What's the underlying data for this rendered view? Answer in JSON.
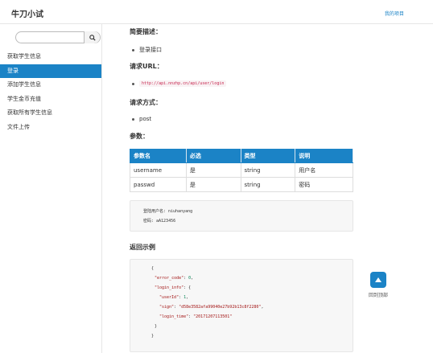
{
  "header": {
    "title": "牛刀小试",
    "project_link": "我的项目"
  },
  "sidebar": {
    "search_placeholder": "",
    "items": [
      {
        "label": "获取学生信息",
        "active": false
      },
      {
        "label": "登录",
        "active": true
      },
      {
        "label": "添加学生信息",
        "active": false
      },
      {
        "label": "学生金币充值",
        "active": false
      },
      {
        "label": "获取所有学生信息",
        "active": false
      },
      {
        "label": "文件上传",
        "active": false
      }
    ]
  },
  "main": {
    "brief_heading": "简要描述：",
    "brief_item": "登录接口",
    "url_heading": "请求URL：",
    "url": "http://api.nnzhp.cn/api/user/login",
    "method_heading": "请求方式：",
    "method": "post",
    "params_heading": "参数：",
    "table": {
      "headers": [
        "参数名",
        "必选",
        "类型",
        "说明"
      ],
      "rows": [
        [
          "username",
          "是",
          "string",
          "用户名"
        ],
        [
          "passwd",
          "是",
          "string",
          "密码"
        ]
      ]
    },
    "note_line1": "登陆用户名: niuhanyang",
    "note_line2": "密码: aA123456",
    "example_heading": "返回示例",
    "example_lines": {
      "l1": "{",
      "l2_key": "\"error_code\"",
      "l2_val": "0",
      "l3_key": "\"login_info\"",
      "l4_key": "\"userId\"",
      "l4_val": "1",
      "l5_key": "\"sign\"",
      "l5_val": "\"d58e3582afa99040e27b92b13c8f2280\"",
      "l6_key": "\"login_time\"",
      "l6_val": "\"20171207113501\"",
      "l7": "}",
      "l8": "}"
    }
  },
  "back_to_top": "回到顶部",
  "colors": {
    "accent": "#1b83c6",
    "code_red": "#c7254e"
  }
}
